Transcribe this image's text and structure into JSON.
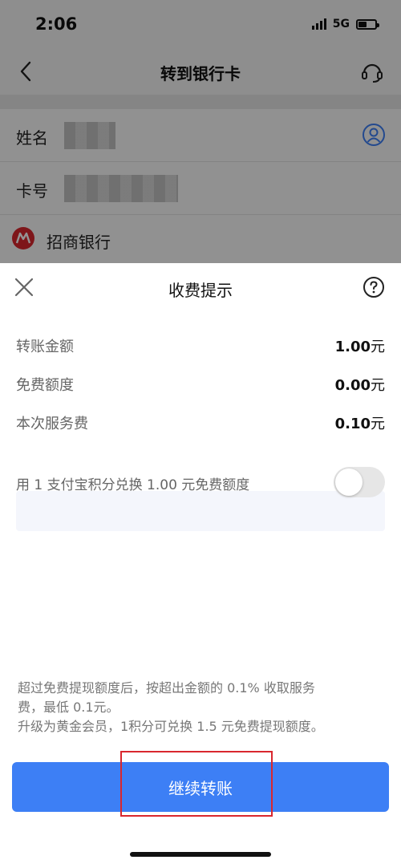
{
  "status_bar": {
    "time": "2:06",
    "network": "5G",
    "icons": [
      "signal-icon",
      "battery-icon"
    ]
  },
  "nav": {
    "title": "转到银行卡",
    "back_icon": "chevron-left-icon",
    "service_icon": "customer-service-icon"
  },
  "form": {
    "name_label": "姓名",
    "card_label": "卡号",
    "bank_name": "招商银行",
    "contact_icon": "person-circle-icon",
    "bank_logo_icon": "cmb-logo-icon",
    "bank_logo_color": "#d9272e"
  },
  "sheet": {
    "title": "收费提示",
    "close_icon": "close-icon",
    "help_icon": "question-circle-icon",
    "rows": [
      {
        "label": "转账金额",
        "value": "1.00",
        "unit": "元"
      },
      {
        "label": "免费额度",
        "value": "0.00",
        "unit": "元"
      },
      {
        "label": "本次服务费",
        "value": "0.10",
        "unit": "元"
      }
    ],
    "exchange": {
      "label": "用 1 支付宝积分兑换 1.00 元免费额度",
      "toggle_on": false
    },
    "notes": [
      "超过免费提现额度后，按超出金额的 0.1% 收取服务",
      "费，最低 0.1元。",
      "升级为黄金会员，1积分可兑换 1.5 元免费提现额度。"
    ],
    "button_label": "继续转账"
  },
  "colors": {
    "accent": "#3d7ff5",
    "highlight": "#d9272e"
  }
}
